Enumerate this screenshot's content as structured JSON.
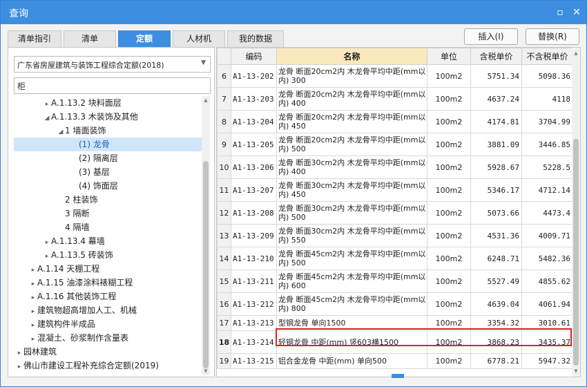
{
  "window": {
    "title": "查询",
    "close_glyph": "✕",
    "restore_glyph": "▫"
  },
  "tabs": [
    {
      "label": "清单指引",
      "active": false
    },
    {
      "label": "清单",
      "active": false
    },
    {
      "label": "定额",
      "active": true
    },
    {
      "label": "人材机",
      "active": false
    },
    {
      "label": "我的数据",
      "active": false
    }
  ],
  "buttons": {
    "insert": "插入(I)",
    "replace": "替换(R)"
  },
  "left": {
    "library": "广东省房屋建筑与装饰工程综合定额(2018)",
    "search_value": "柜",
    "tree": [
      {
        "label": "A.1.13.2 块料面层",
        "arrow": "▸",
        "level": 2
      },
      {
        "label": "A.1.13.3 木装饰及其他",
        "arrow": "◢",
        "level": 2
      },
      {
        "label": "1 墙面装饰",
        "arrow": "◢",
        "level": 3
      },
      {
        "label": "(1) 龙骨",
        "arrow": "",
        "level": 4,
        "selected": true
      },
      {
        "label": "(2) 隔离层",
        "arrow": "",
        "level": 4
      },
      {
        "label": "(3) 基层",
        "arrow": "",
        "level": 4
      },
      {
        "label": "(4) 饰面层",
        "arrow": "",
        "level": 4
      },
      {
        "label": "2 柱装饰",
        "arrow": "",
        "level": 3
      },
      {
        "label": "3 隔断",
        "arrow": "",
        "level": 3
      },
      {
        "label": "4 隔墙",
        "arrow": "",
        "level": 3
      },
      {
        "label": "A.1.13.4 幕墙",
        "arrow": "▸",
        "level": 2
      },
      {
        "label": "A.1.13.5 砖装饰",
        "arrow": "▸",
        "level": 2
      },
      {
        "label": "A.1.14 天棚工程",
        "arrow": "▸",
        "level": 1
      },
      {
        "label": "A.1.15 油漆涂料裱糊工程",
        "arrow": "▸",
        "level": 1
      },
      {
        "label": "A.1.16 其他装饰工程",
        "arrow": "▸",
        "level": 1
      },
      {
        "label": "建筑物超高增加人工、机械",
        "arrow": "▸",
        "level": 1
      },
      {
        "label": "建筑构件半成品",
        "arrow": "▸",
        "level": 1
      },
      {
        "label": "混凝土、砂浆制作含量表",
        "arrow": "▸",
        "level": 1
      },
      {
        "label": "园林建筑",
        "arrow": "▸",
        "level": 0
      },
      {
        "label": "佛山市建设工程补充综合定额(2019)",
        "arrow": "▸",
        "level": 0
      }
    ]
  },
  "table": {
    "headers": [
      "",
      "编码",
      "名称",
      "单位",
      "含税单价",
      "不含税单价"
    ],
    "rows": [
      {
        "idx": "6",
        "code": "A1-13-202",
        "name": "龙骨 断面20cm2内 木龙骨平均中距(mm以内) 300",
        "unit": "100m2",
        "tax": "5751.34",
        "notax": "5098.36"
      },
      {
        "idx": "7",
        "code": "A1-13-203",
        "name": "龙骨 断面20cm2内 木龙骨平均中距(mm以内) 400",
        "unit": "100m2",
        "tax": "4637.24",
        "notax": "4118"
      },
      {
        "idx": "8",
        "code": "A1-13-204",
        "name": "龙骨 断面20cm2内 木龙骨平均中距(mm以内) 450",
        "unit": "100m2",
        "tax": "4174.81",
        "notax": "3704.99"
      },
      {
        "idx": "9",
        "code": "A1-13-205",
        "name": "龙骨 断面20cm2内 木龙骨平均中距(mm以内) 500",
        "unit": "100m2",
        "tax": "3881.09",
        "notax": "3446.85"
      },
      {
        "idx": "10",
        "code": "A1-13-206",
        "name": "龙骨 断面30cm2内 木龙骨平均中距(mm以内) 400",
        "unit": "100m2",
        "tax": "5928.67",
        "notax": "5228.5"
      },
      {
        "idx": "11",
        "code": "A1-13-207",
        "name": "龙骨 断面30cm2内 木龙骨平均中距(mm以内) 450",
        "unit": "100m2",
        "tax": "5346.17",
        "notax": "4712.14"
      },
      {
        "idx": "12",
        "code": "A1-13-208",
        "name": "龙骨 断面30cm2内 木龙骨平均中距(mm以内) 500",
        "unit": "100m2",
        "tax": "5073.66",
        "notax": "4473.4"
      },
      {
        "idx": "13",
        "code": "A1-13-209",
        "name": "龙骨 断面30cm2内 木龙骨平均中距(mm以内) 550",
        "unit": "100m2",
        "tax": "4531.36",
        "notax": "4009.71"
      },
      {
        "idx": "14",
        "code": "A1-13-210",
        "name": "龙骨 断面45cm2内 木龙骨平均中距(mm以内) 500",
        "unit": "100m2",
        "tax": "6248.71",
        "notax": "5482.36"
      },
      {
        "idx": "15",
        "code": "A1-13-211",
        "name": "龙骨 断面45cm2内 木龙骨平均中距(mm以内) 600",
        "unit": "100m2",
        "tax": "5527.49",
        "notax": "4855.62"
      },
      {
        "idx": "16",
        "code": "A1-13-212",
        "name": "龙骨 断面45cm2内 木龙骨平均中距(mm以内) 800",
        "unit": "100m2",
        "tax": "4639.04",
        "notax": "4061.94"
      },
      {
        "idx": "17",
        "code": "A1-13-213",
        "name": "型钢龙骨 单向1500",
        "unit": "100m2",
        "tax": "3354.32",
        "notax": "3010.61"
      },
      {
        "idx": "18",
        "code": "A1-13-214",
        "name": "轻钢龙骨 中距(mm) 竖603横1500",
        "unit": "100m2",
        "tax": "3868.23",
        "notax": "3435.37"
      },
      {
        "idx": "19",
        "code": "A1-13-215",
        "name": "铝合金龙骨 中距(mm) 单向500",
        "unit": "100m2",
        "tax": "6778.21",
        "notax": "5947.32"
      }
    ]
  }
}
